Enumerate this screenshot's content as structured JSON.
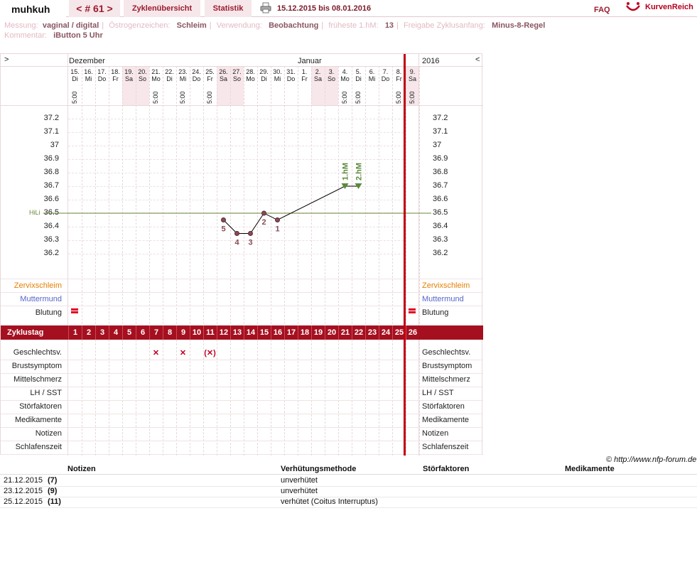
{
  "header": {
    "user": "muhkuh",
    "cycle_label": "< # 61 >",
    "tab_overview": "Zyklenübersicht",
    "tab_stats": "Statistik",
    "date_range": "15.12.2015 bis 08.01.2016",
    "faq": "FAQ",
    "logo": "KurvenReich",
    "printer_icon": "printer-icon"
  },
  "meta": {
    "messung_k": "Messung:",
    "messung_v": "vaginal / digital",
    "oestro_k": "Östrogenzeichen:",
    "oestro_v": "Schleim",
    "verw_k": "Verwendung:",
    "verw_v": "Beobachtung",
    "hm_k": "früheste 1.hM:",
    "hm_v": "13",
    "freigabe_k": "Freigabe Zyklusanfang:",
    "freigabe_v": "Minus-8-Regel",
    "komm_k": "Kommentar:",
    "komm_v": "iButton 5 Uhr"
  },
  "chart": {
    "nav_prev": ">",
    "nav_next": "<",
    "month_dec": "Dezember",
    "month_jan": "Januar",
    "year": "2016",
    "hili_label": "HiLi",
    "time": "5:00",
    "colors": {
      "accent": "#a51020",
      "red_line": "#c00010",
      "curve": "#000000",
      "hili": "#6a8a3a",
      "peak": "#5a8a3a"
    }
  },
  "chart_data": {
    "type": "line",
    "days": [
      {
        "d": "15.",
        "w": "Di",
        "t": "5:00",
        "we": false
      },
      {
        "d": "16.",
        "w": "Mi",
        "t": "",
        "we": false
      },
      {
        "d": "17.",
        "w": "Do",
        "t": "",
        "we": false
      },
      {
        "d": "18.",
        "w": "Fr",
        "t": "",
        "we": false
      },
      {
        "d": "19.",
        "w": "Sa",
        "t": "",
        "we": true
      },
      {
        "d": "20.",
        "w": "So",
        "t": "",
        "we": true
      },
      {
        "d": "21.",
        "w": "Mo",
        "t": "5:00",
        "we": false
      },
      {
        "d": "22.",
        "w": "Di",
        "t": "",
        "we": false
      },
      {
        "d": "23.",
        "w": "Mi",
        "t": "5:00",
        "we": false
      },
      {
        "d": "24.",
        "w": "Do",
        "t": "",
        "we": false
      },
      {
        "d": "25.",
        "w": "Fr",
        "t": "5:00",
        "we": false
      },
      {
        "d": "26.",
        "w": "Sa",
        "t": "",
        "we": true
      },
      {
        "d": "27.",
        "w": "So",
        "t": "",
        "we": true
      },
      {
        "d": "28.",
        "w": "Mo",
        "t": "",
        "we": false
      },
      {
        "d": "29.",
        "w": "Di",
        "t": "",
        "we": false
      },
      {
        "d": "30.",
        "w": "Mi",
        "t": "",
        "we": false
      },
      {
        "d": "31.",
        "w": "Do",
        "t": "",
        "we": false
      },
      {
        "d": "1.",
        "w": "Fr",
        "t": "",
        "we": false
      },
      {
        "d": "2.",
        "w": "Sa",
        "t": "",
        "we": true
      },
      {
        "d": "3.",
        "w": "So",
        "t": "",
        "we": true
      },
      {
        "d": "4.",
        "w": "Mo",
        "t": "5:00",
        "we": false
      },
      {
        "d": "5.",
        "w": "Di",
        "t": "5:00",
        "we": false
      },
      {
        "d": "6.",
        "w": "Mi",
        "t": "",
        "we": false
      },
      {
        "d": "7.",
        "w": "Do",
        "t": "",
        "we": false
      },
      {
        "d": "8.",
        "w": "Fr",
        "t": "5:00",
        "we": false
      },
      {
        "d": "9.",
        "w": "Sa",
        "t": "5:00",
        "we": true
      }
    ],
    "y_ticks": [
      "37.2",
      "37.1",
      "37",
      "36.9",
      "36.8",
      "36.7",
      "36.6",
      "36.5",
      "36.4",
      "36.3",
      "36.2"
    ],
    "ylim": [
      36.1,
      37.3
    ],
    "hili": 36.5,
    "temps": [
      {
        "day": 12,
        "temp": 36.45,
        "label": "5"
      },
      {
        "day": 13,
        "temp": 36.35,
        "label": "4"
      },
      {
        "day": 14,
        "temp": 36.35,
        "label": "3"
      },
      {
        "day": 15,
        "temp": 36.5,
        "label": "2"
      },
      {
        "day": 16,
        "temp": 36.45,
        "label": "1"
      },
      {
        "day": 21,
        "temp": 36.7,
        "label": "1.hM"
      },
      {
        "day": 22,
        "temp": 36.7,
        "label": "2.hM"
      }
    ]
  },
  "rows_top": [
    "Zervixschleim",
    "Muttermund",
    "Blutung"
  ],
  "cycle_label": "Zyklustag",
  "cycle_days": [
    "1",
    "2",
    "3",
    "4",
    "5",
    "6",
    "7",
    "8",
    "9",
    "10",
    "11",
    "12",
    "13",
    "14",
    "15",
    "16",
    "17",
    "18",
    "19",
    "20",
    "21",
    "22",
    "23",
    "24",
    "25",
    "26"
  ],
  "rows_bottom": [
    "Geschlechtsv.",
    "Brustsymptom",
    "Mittelschmerz",
    "LH / SST",
    "Störfaktoren",
    "Medikamente",
    "Notizen",
    "Schlafenszeit"
  ],
  "intercourse": [
    {
      "day": 7,
      "mark": "✕"
    },
    {
      "day": 9,
      "mark": "✕"
    },
    {
      "day": 11,
      "mark": "(✕)"
    }
  ],
  "bleeding": [
    1,
    26
  ],
  "copyright": "© http://www.nfp-forum.de",
  "notes_table": {
    "headers": [
      "Notizen",
      "Verhütungsmethode",
      "Störfaktoren",
      "Medikamente"
    ],
    "rows": [
      {
        "date": "21.12.2015",
        "day": "(7)",
        "method": "unverhütet"
      },
      {
        "date": "23.12.2015",
        "day": "(9)",
        "method": "unverhütet"
      },
      {
        "date": "25.12.2015",
        "day": "(11)",
        "method": "verhütet (Coitus Interruptus)"
      }
    ]
  }
}
